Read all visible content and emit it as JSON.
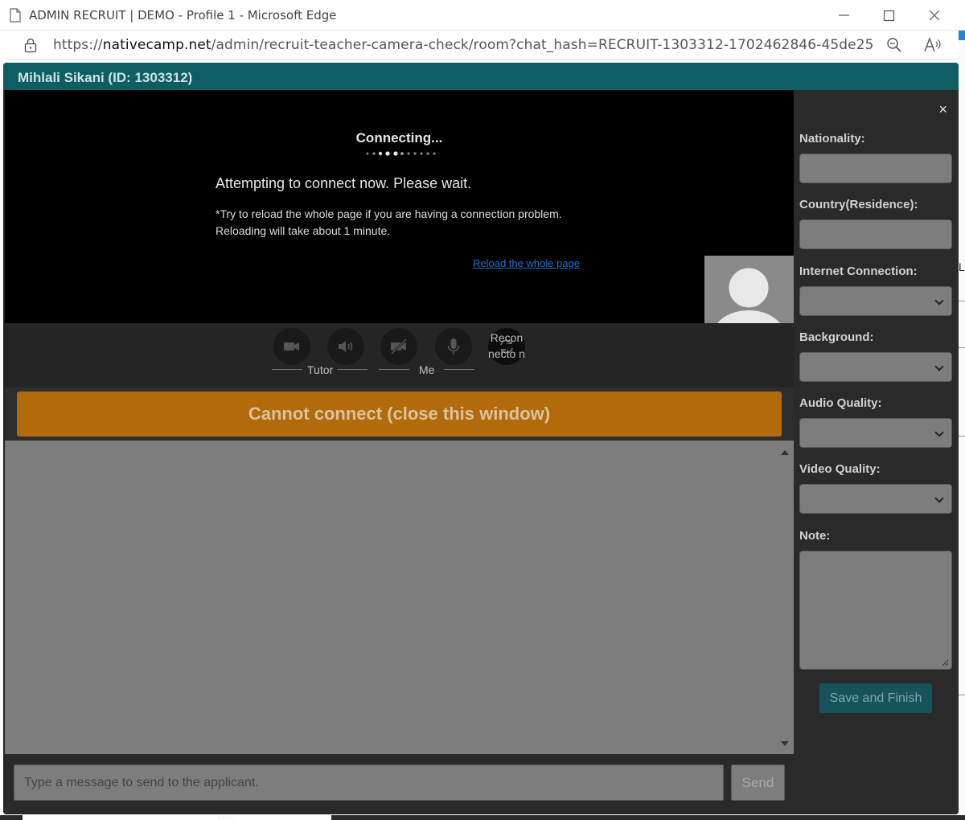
{
  "browser": {
    "title": "ADMIN RECRUIT | DEMO - Profile 1 - Microsoft Edge",
    "url_prefix": "https://",
    "url_domain": "nativecamp.net",
    "url_path": "/admin/recruit-teacher-camera-check/room?chat_hash=RECRUIT-1303312-1702462846-45de25"
  },
  "background": {
    "edge_letter": "L"
  },
  "header": {
    "name": "Mihlali Sikani (ID: 1303312)"
  },
  "video": {
    "connecting": "Connecting...",
    "attempt": "Attempting to connect now. Please wait.",
    "hint": "*Try to reload the whole page if you are having a connection problem.\nReloading will take about 1 minute.",
    "reload_link": "Reload the whole page"
  },
  "controls": {
    "tutor_label": "Tutor",
    "me_label": "Me",
    "reconnect_label": "Recon necto n",
    "icons": [
      "camera-icon",
      "speaker-icon",
      "camera-off-icon",
      "microphone-icon",
      "reconnect-icon"
    ]
  },
  "cannot_connect": "Cannot connect (close this window)",
  "chat": {
    "placeholder": "Type a message to send to the applicant.",
    "send": "Send"
  },
  "panel": {
    "close": "×",
    "nationality": "Nationality:",
    "country": "Country(Residence):",
    "internet": "Internet Connection:",
    "background": "Background:",
    "audio": "Audio Quality:",
    "video": "Video Quality:",
    "note": "Note:",
    "save": "Save and Finish"
  },
  "colors": {
    "header": "#0e5d62",
    "cannot_connect": "#b26a0b",
    "save": "#16535a",
    "link": "#1e73c8"
  }
}
